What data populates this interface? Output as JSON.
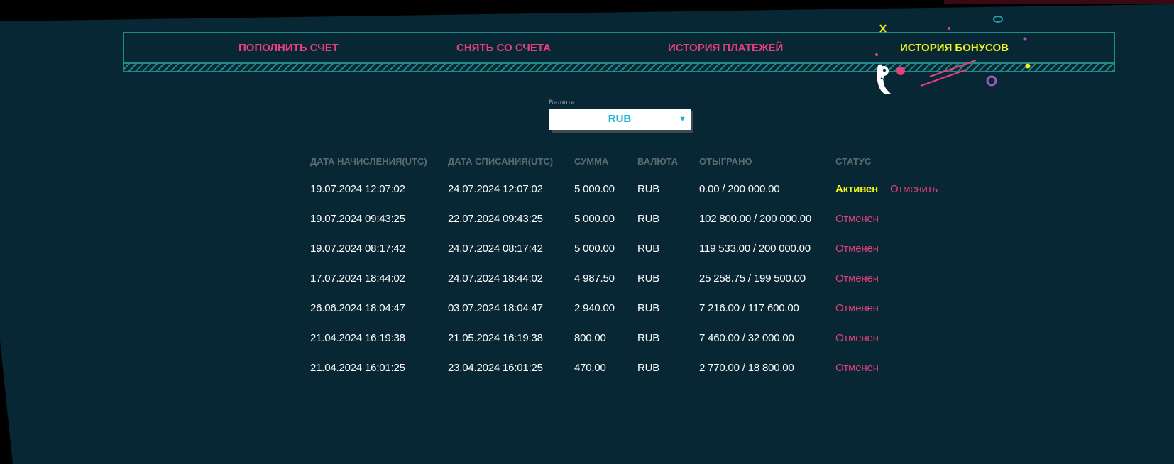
{
  "tabs": [
    {
      "label": "ПОПОЛНИТЬ СЧЕТ",
      "active": false
    },
    {
      "label": "СНЯТЬ СО СЧЕТА",
      "active": false
    },
    {
      "label": "ИСТОРИЯ ПЛАТЕЖЕЙ",
      "active": false
    },
    {
      "label": "ИСТОРИЯ БОНУСОВ",
      "active": true
    }
  ],
  "currency": {
    "label": "Валюта:",
    "selected": "RUB"
  },
  "table": {
    "headers": {
      "accrual_date": "ДАТА НАЧИСЛЕНИЯ(UTC)",
      "writeoff_date": "ДАТА СПИСАНИЯ(UTC)",
      "amount": "СУММА",
      "currency": "ВАЛЮТА",
      "wagered": "ОТЫГРАНО",
      "status": "СТАТУС"
    },
    "rows": [
      {
        "accrual": "19.07.2024 12:07:02",
        "writeoff": "24.07.2024 12:07:02",
        "amount": "5 000.00",
        "currency": "RUB",
        "wagered": "0.00 / 200 000.00",
        "status": "Активен",
        "action": "Отменить"
      },
      {
        "accrual": "19.07.2024 09:43:25",
        "writeoff": "22.07.2024 09:43:25",
        "amount": "5 000.00",
        "currency": "RUB",
        "wagered": "102 800.00 / 200 000.00",
        "status": "Отменен"
      },
      {
        "accrual": "19.07.2024 08:17:42",
        "writeoff": "24.07.2024 08:17:42",
        "amount": "5 000.00",
        "currency": "RUB",
        "wagered": "119 533.00 / 200 000.00",
        "status": "Отменен"
      },
      {
        "accrual": "17.07.2024 18:44:02",
        "writeoff": "24.07.2024 18:44:02",
        "amount": "4 987.50",
        "currency": "RUB",
        "wagered": "25 258.75 / 199 500.00",
        "status": "Отменен"
      },
      {
        "accrual": "26.06.2024 18:04:47",
        "writeoff": "03.07.2024 18:04:47",
        "amount": "2 940.00",
        "currency": "RUB",
        "wagered": "7 216.00 / 117 600.00",
        "status": "Отменен"
      },
      {
        "accrual": "21.04.2024 16:19:38",
        "writeoff": "21.05.2024 16:19:38",
        "amount": "800.00",
        "currency": "RUB",
        "wagered": "7 460.00 / 32 000.00",
        "status": "Отменен"
      },
      {
        "accrual": "21.04.2024 16:01:25",
        "writeoff": "23.04.2024 16:01:25",
        "amount": "470.00",
        "currency": "RUB",
        "wagered": "2 770.00 / 18 800.00",
        "status": "Отменен"
      }
    ]
  },
  "colors": {
    "background": "#072735",
    "accent_pink": "#e63f7a",
    "accent_yellow": "#f2f21c",
    "border_teal": "#1e8a8a",
    "select_text": "#19b3d8"
  },
  "icons": {
    "dropdown": "caret-down-icon",
    "decoration": "confetti-mascot-icon"
  }
}
